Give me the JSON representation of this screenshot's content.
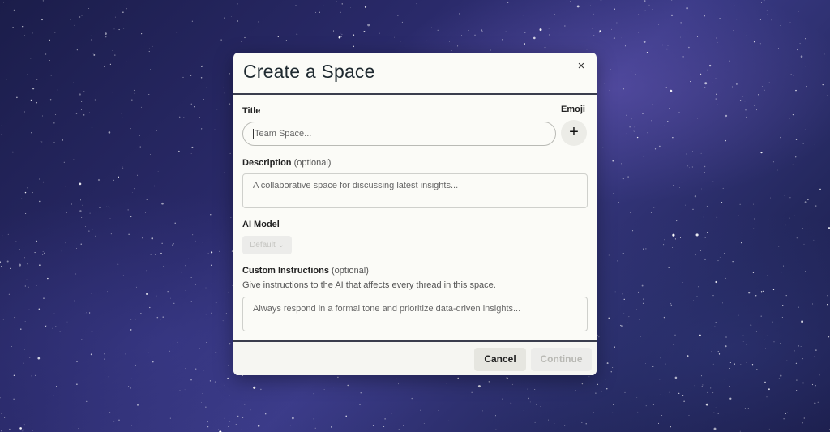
{
  "modal": {
    "title": "Create a Space",
    "close_symbol": "×"
  },
  "form": {
    "title_label": "Title",
    "title_placeholder": "Team Space...",
    "emoji_label": "Emoji",
    "emoji_button_symbol": "+",
    "description_label": "Description",
    "description_optional": "(optional)",
    "description_placeholder": "A collaborative space for discussing latest insights...",
    "model_label": "AI Model",
    "model_selected": "Default",
    "instructions_label": "Custom Instructions",
    "instructions_optional": "(optional)",
    "instructions_helper": "Give instructions to the AI that affects every thread in this space.",
    "instructions_placeholder": "Always respond in a formal tone and prioritize data-driven insights..."
  },
  "footer": {
    "cancel_label": "Cancel",
    "continue_label": "Continue"
  },
  "icons": {
    "close": "close-icon",
    "emoji_add": "plus-icon",
    "dropdown": "chevron-down-icon"
  },
  "colors": {
    "modal_bg": "#fbfbf7",
    "divider": "#3a3d4d",
    "backdrop": "#24285e"
  }
}
